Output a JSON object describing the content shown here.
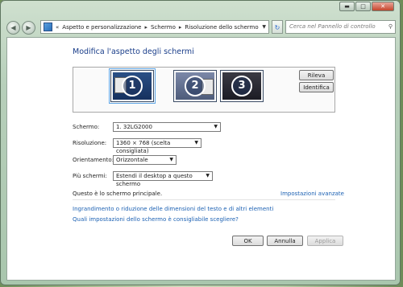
{
  "window": {
    "controls": {
      "minimize": "▬",
      "maximize": "□",
      "close": "✕"
    }
  },
  "address": {
    "back": "◀",
    "forward": "▶",
    "crumbs": [
      "Aspetto e personalizzazione",
      "Schermo",
      "Risoluzione dello schermo"
    ],
    "search_placeholder": "Cerca nel Pannello di controllo"
  },
  "page": {
    "heading": "Modifica l'aspetto degli schermi",
    "buttons": {
      "detect": "Rileva",
      "identify": "Identifica"
    },
    "monitors": [
      "1",
      "2",
      "3"
    ],
    "fields": {
      "display_label": "Schermo:",
      "display_value": "1. 32LG2000",
      "resolution_label": "Risoluzione:",
      "resolution_value": "1360 × 768 (scelta consigliata)",
      "orientation_label": "Orientamento:",
      "orientation_value": "Orizzontale",
      "multi_label": "Più schermi:",
      "multi_value": "Estendi il desktop a questo schermo"
    },
    "primary_text": "Questo è lo schermo principale.",
    "advanced_link": "Impostazioni avanzate",
    "link1": "Ingrandimento o riduzione delle dimensioni del testo e di altri elementi",
    "link2": "Quali impostazioni dello schermo è consigliabile scegliere?",
    "ok": "OK",
    "cancel": "Annulla",
    "apply": "Applica"
  }
}
